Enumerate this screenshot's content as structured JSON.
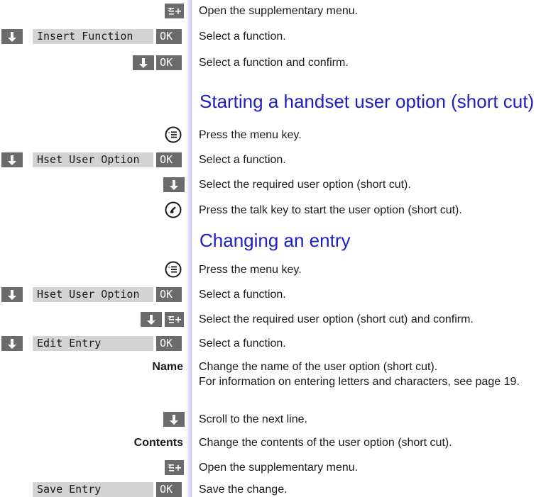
{
  "accent_color": "#1e1ebe",
  "section_top": [
    {
      "text": "Open the supplementary menu."
    },
    {
      "text": "Select a function.",
      "display": "Insert Function",
      "ok": "OK"
    },
    {
      "text": "Select a function and confirm.",
      "ok": "OK"
    }
  ],
  "section_shortcut": {
    "heading": "Starting a handset user option (short cut)",
    "steps": [
      {
        "text": "Press the menu key.",
        "icon": "menu-key-icon"
      },
      {
        "text": "Select a function.",
        "display": "Hset User Option",
        "ok": "OK"
      },
      {
        "text": "Select the required user option (short cut).",
        "icon": "down-arrow-icon"
      },
      {
        "text": "Press the talk key to start the user option (short cut).",
        "icon": "talk-key-icon"
      }
    ]
  },
  "section_change": {
    "heading": "Changing an entry",
    "steps": [
      {
        "text": "Press the menu key.",
        "icon": "menu-key-icon"
      },
      {
        "text": "Select a function.",
        "display": "Hset User Option",
        "ok": "OK"
      },
      {
        "text": "Select the required user option (short cut) and confirm.",
        "icon": "down-arrow-icon"
      },
      {
        "text": "Select a function.",
        "display": "Edit Entry",
        "ok": "OK"
      },
      {
        "label": "Name",
        "line1": "Change the name of the user option (short cut).",
        "line2": "For information on entering letters and characters, see page 19."
      },
      {
        "text": "Scroll to the next line.",
        "icon": "down-arrow-icon"
      },
      {
        "label": "Contents",
        "text": "Change the contents of the user option (short cut)."
      },
      {
        "text": "Open the supplementary menu.",
        "icon": "supplementary-menu-icon"
      },
      {
        "text": "Save the change.",
        "display": "Save Entry",
        "ok": "OK"
      }
    ]
  }
}
